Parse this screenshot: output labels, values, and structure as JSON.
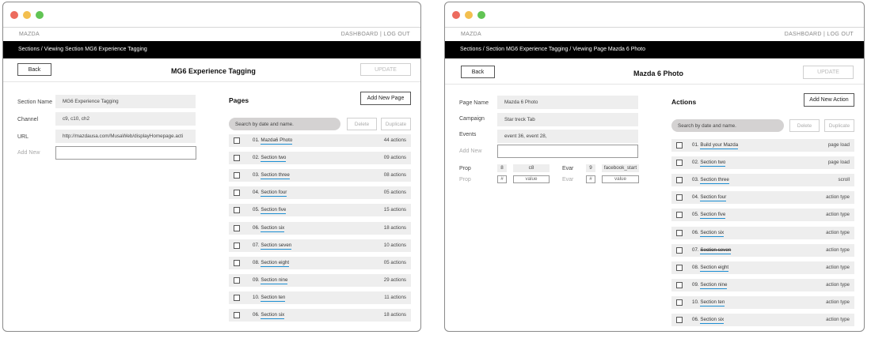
{
  "window1": {
    "brand": "MAZDA",
    "nav_dashboard": "DASHBOARD",
    "nav_separator": "|",
    "nav_logout": "LOG OUT",
    "breadcrumb": "Sections / Viewing Section MG6 Experience Tagging",
    "back_label": "Back",
    "title": "MG6 Experience Tagging",
    "update_label": "UPDATE",
    "fields": {
      "section_name_label": "Section Name",
      "section_name_value": "MG6 Experience Tagging",
      "channel_label": "Channel",
      "channel_value": "c9, c10, ch2",
      "url_label": "URL",
      "url_value": "http://mazdausa.com/MusaWeb/displayHomepage.acti",
      "add_new_label": "Add New"
    },
    "pages": {
      "title": "Pages",
      "add_label": "Add New Page",
      "search_placeholder": "Search by date and name.",
      "delete_label": "Delete",
      "duplicate_label": "Duplicate",
      "rows": [
        {
          "num": "01.",
          "name": "Mazda6 Photo",
          "count": "44 actions"
        },
        {
          "num": "02.",
          "name": "Section two",
          "count": "09 actions"
        },
        {
          "num": "03.",
          "name": "Section three",
          "count": "08 actions"
        },
        {
          "num": "04.",
          "name": "Section four",
          "count": "05 actions"
        },
        {
          "num": "05.",
          "name": "Section five",
          "count": "15 actions"
        },
        {
          "num": "06.",
          "name": "Section six",
          "count": "18 actions"
        },
        {
          "num": "07.",
          "name": "Section seven",
          "count": "10 actions"
        },
        {
          "num": "08.",
          "name": "Section eight",
          "count": "05 actions"
        },
        {
          "num": "09.",
          "name": "Section nine",
          "count": "29 actions"
        },
        {
          "num": "10.",
          "name": "Section ten",
          "count": "11 actions"
        },
        {
          "num": "06.",
          "name": "Section six",
          "count": "18 actions"
        }
      ]
    }
  },
  "window2": {
    "brand": "MAZDA",
    "nav_dashboard": "DASHBOARD",
    "nav_separator": "|",
    "nav_logout": "LOG OUT",
    "breadcrumb": "Sections /  Section MG6 Experience Tagging / Viewing Page Mazda 6 Photo",
    "back_label": "Back",
    "title": "Mazda 6 Photo",
    "update_label": "UPDATE",
    "fields": {
      "page_name_label": "Page Name",
      "page_name_value": "Mazda 6 Photo",
      "campaign_label": "Campaign",
      "campaign_value": "Star treck Tab",
      "events_label": "Events",
      "events_value": "event 36, event 28,",
      "add_new_label": "Add New",
      "prop_label": "Prop",
      "prop_num": "8",
      "prop_value": "c8",
      "evar_label": "Evar",
      "evar_num": "9",
      "evar_value": "facebook_start",
      "prop2_label": "Prop",
      "prop2_num": "#",
      "prop2_value": "value",
      "evar2_label": "Evar",
      "evar2_num": "#",
      "evar2_value": "value"
    },
    "actions": {
      "title": "Actions",
      "add_label": "Add New Action",
      "search_placeholder": "Search by date and name.",
      "delete_label": "Delete",
      "duplicate_label": "Duplicate",
      "rows": [
        {
          "num": "01.",
          "name": "Build your Mazda",
          "type": "page load"
        },
        {
          "num": "02.",
          "name": "Section two",
          "type": "page load"
        },
        {
          "num": "03.",
          "name": "Section three",
          "type": "scroll"
        },
        {
          "num": "04.",
          "name": "Section four",
          "type": "action type"
        },
        {
          "num": "05.",
          "name": "Section five",
          "type": "action type"
        },
        {
          "num": "06.",
          "name": "Section six",
          "type": "action type"
        },
        {
          "num": "07.",
          "name": "Section seven",
          "type": "action type"
        },
        {
          "num": "08.",
          "name": "Section eight",
          "type": "action type"
        },
        {
          "num": "09.",
          "name": "Section nine",
          "type": "action type"
        },
        {
          "num": "10.",
          "name": "Section ten",
          "type": "action type"
        },
        {
          "num": "06.",
          "name": "Section six",
          "type": "action type"
        }
      ]
    }
  },
  "colors": {
    "breadcrumb_bg": "#000000",
    "field_bg": "#eeeeee",
    "link_underline": "#1d8fd3",
    "search_bg": "#d4d2d2"
  }
}
